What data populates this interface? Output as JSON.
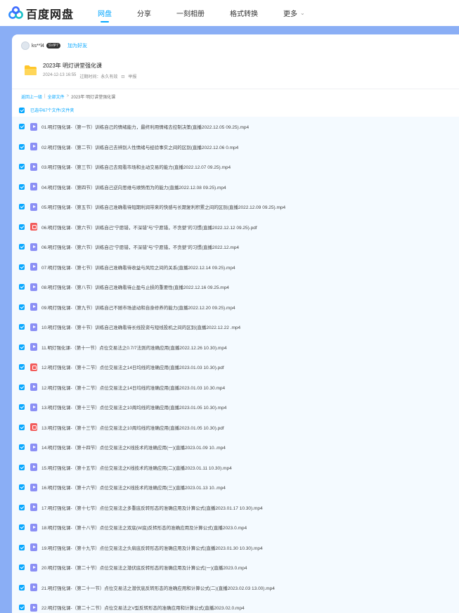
{
  "brand": {
    "name": "百度网盘"
  },
  "nav": [
    {
      "label": "网盘",
      "active": true
    },
    {
      "label": "分享",
      "active": false
    },
    {
      "label": "一刻相册",
      "active": false
    },
    {
      "label": "格式转换",
      "active": false
    },
    {
      "label": "更多",
      "active": false,
      "has_caret": true
    }
  ],
  "sharer": {
    "name": "ks**l4",
    "vip_badge": "SVIP7",
    "add_friend": "加为好友"
  },
  "share": {
    "title": "2023年 明灯讲堂强化课",
    "date": "2024-12-13 16:55",
    "expire": "过期时间：永久有效",
    "report": "举报"
  },
  "breadcrumb": {
    "back": "返回上一级",
    "all": "全部文件",
    "sep": ">",
    "current": "2023年 明灯讲堂强化课"
  },
  "selection": {
    "label": "已选中67个文件/文件夹"
  },
  "files": [
    {
      "type": "video",
      "name": "01.明灯强化课-（第一节）训练自己的情绪能力，最终利用情绪去控制决策(直播2022.12.05 09.25).mp4"
    },
    {
      "type": "video",
      "name": "02.明灯强化课-（第二节）训练自己去辨别人性情绪与经验事实之间的区别(直播2022.12.06 0.mp4"
    },
    {
      "type": "video",
      "name": "03.明灯强化课-（第三节）训练自己去观看市场和主动交易的能力(直播2022.12.07 09.25).mp4"
    },
    {
      "type": "video",
      "name": "04.明灯强化课-（第四节）训练自己逆向思维与顺势而为的能力(直播2022.12.08 09.25).mp4"
    },
    {
      "type": "video",
      "name": "05.明灯强化课-（第五节）训练自己准确看待短期利润带来的快感与长期复利积累之间的区别(直播2022.12.09 09.25).mp4"
    },
    {
      "type": "pdf",
      "name": "06.明灯强化课-（第六节）训练自己“宁愿错，不深错”与“宁愿错，不贪婪”的习惯(直播2022.12.12 09.25).pdf"
    },
    {
      "type": "video",
      "name": "06.明灯强化课-（第六节）训练自己“宁愿错，不深错”与“宁愿错，不贪婪”的习惯(直播2022.12.mp4"
    },
    {
      "type": "video",
      "name": "07.明灯强化课-（第七节）训练自己准确看待收益与风险之间的关系(直播2022.12.14 09.25).mp4"
    },
    {
      "type": "video",
      "name": "08.明灯强化课-（第八节）训练自己准确看待止盈与止损的重要性(直播2022.12.16 09.25.mp4"
    },
    {
      "type": "video",
      "name": "09.明灯强化课-（第九节）训练自己不随市场波动和自身修养的能力(直播2022.12.20 09.25).mp4"
    },
    {
      "type": "video",
      "name": "10.明灯强化课-（第十节）训练自己准确看待长线投资与短线投机之间的区别(直播2022.12.22 .mp4"
    },
    {
      "type": "video",
      "name": "11.明灯强化课-（第十一节）点位交易法之0.7/7法则的准确应用(直播2022.12.26 10.30).mp4"
    },
    {
      "type": "pdf",
      "name": "12.明灯强化课-（第十二节）点位交易法之14日均线的准确应用(直播2023.01.03 10.30).pdf"
    },
    {
      "type": "video",
      "name": "12.明灯强化课-（第十二节）点位交易法之14日均线的准确应用(直播2023.01.03 10.30.mp4"
    },
    {
      "type": "video",
      "name": "13.明灯强化课-（第十三节）点位交易法之10周均线的准确应用(直播2023.01.05 10.30).mp4"
    },
    {
      "type": "pdf",
      "name": "13.明灯强化课-（第十三节）点位交易法之10周均线的准确应用(直播2023.01.05 10.30).pdf"
    },
    {
      "type": "video",
      "name": "14.明灯强化课-（第十四节）点位交易法之K线技术的准确应用(一)(直播2023.01.09 10..mp4"
    },
    {
      "type": "video",
      "name": "15.明灯强化课-（第十五节）点位交易法之K线技术的准确应用(二)(直播2023.01.11 10.30).mp4"
    },
    {
      "type": "video",
      "name": "16.明灯强化课-（第十六节）点位交易法之K线技术的准确应用(三)(直播2023.01.13 10..mp4"
    },
    {
      "type": "video",
      "name": "17.明灯强化课-（第十七节）点位交易法之多重底反转形态的准确应用及计算公式(直播2023.01.17 10.30).mp4"
    },
    {
      "type": "video",
      "name": "18.明灯强化课-（第十八节）点位交易法之双底(W底)反转形态的准确应用及计算公式(直播2023.0.mp4"
    },
    {
      "type": "video",
      "name": "19.明灯强化课-（第十九节）点位交易法之头肩底反转形态的准确应用及计算公式(直播2023.01.30 10.30).mp4"
    },
    {
      "type": "video",
      "name": "20.明灯强化课-（第二十节）点位交易法之潜伏底反转形态的准确应用及计算公式(一)(直播2023.0.mp4"
    },
    {
      "type": "video",
      "name": "21.明灯强化课-（第二十一节）点位交易法之潜伏底反转形态的准确应用和计算公式(二)(直播2023.02.03 13.00).mp4"
    },
    {
      "type": "video",
      "name": "22.明灯强化课-（第二十二节）点位交易法之V型反转形态的准确应用和计算公式(直播2023.02.0.mp4"
    }
  ]
}
